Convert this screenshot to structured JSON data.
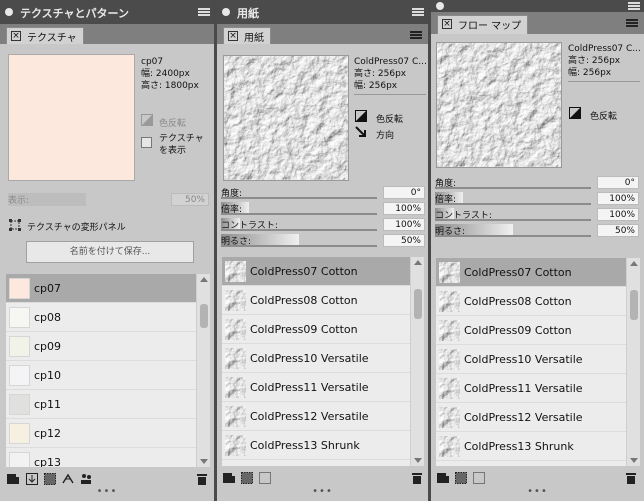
{
  "panels": {
    "texture": {
      "title": "テクスチャとパターン",
      "tab": "テクスチャ",
      "info": {
        "name": "cp07",
        "width": "幅: 2400px",
        "height": "高さ: 1800px"
      },
      "swatch_color": "#fce8dc",
      "invert_label": "色反転",
      "show_texture_label": "テクスチャ を表示",
      "opacity_label": "表示:",
      "opacity_value": "50%",
      "transform_label": "テクスチャの変形パネル",
      "save_button": "名前を付けて保存...",
      "items": [
        {
          "name": "cp07",
          "color": "#fce8dc"
        },
        {
          "name": "cp08",
          "color": "#f6f6f3"
        },
        {
          "name": "cp09",
          "color": "#f2f3e8"
        },
        {
          "name": "cp10",
          "color": "#f4f4f6"
        },
        {
          "name": "cp11",
          "color": "#e0e0df"
        },
        {
          "name": "cp12",
          "color": "#f5f0e0"
        },
        {
          "name": "cp13",
          "color": "#f2f2f2"
        }
      ]
    },
    "paper": {
      "title": "用紙",
      "tab": "用紙",
      "info": {
        "name": "ColdPress07 C...",
        "width": "高さ: 256px",
        "height": "幅: 256px"
      },
      "invert_label": "色反転",
      "direction_label": "方向",
      "sliders": [
        {
          "label": "角度:",
          "value": "0°",
          "level": 0
        },
        {
          "label": "倍率:",
          "value": "100%",
          "level": 0.18
        },
        {
          "label": "コントラスト:",
          "value": "100%",
          "level": 0.12
        },
        {
          "label": "明るさ:",
          "value": "50%",
          "level": 0.5
        }
      ],
      "items": [
        "ColdPress07 Cotton",
        "ColdPress08 Cotton",
        "ColdPress09 Cotton",
        "ColdPress10 Versatile",
        "ColdPress11 Versatile",
        "ColdPress12 Versatile",
        "ColdPress13 Shrunk"
      ]
    },
    "flowmap": {
      "tab": "フロー マップ",
      "info": {
        "name": "ColdPress07 C...",
        "width": "高さ: 256px",
        "height": "幅: 256px"
      },
      "invert_label": "色反転",
      "sliders": [
        {
          "label": "角度:",
          "value": "0°",
          "level": 0
        },
        {
          "label": "倍率:",
          "value": "100%",
          "level": 0.18
        },
        {
          "label": "コントラスト:",
          "value": "100%",
          "level": 0.12
        },
        {
          "label": "明るさ:",
          "value": "50%",
          "level": 0.5
        }
      ],
      "items": [
        "ColdPress07 Cotton",
        "ColdPress08 Cotton",
        "ColdPress09 Cotton",
        "ColdPress10 Versatile",
        "ColdPress11 Versatile",
        "ColdPress12 Versatile",
        "ColdPress13 Shrunk"
      ]
    }
  },
  "icons": {
    "menu": "hamburger-icon",
    "close": "close-icon",
    "invert": "invert-icon",
    "direction": "direction-arrow-icon",
    "transform": "transform-icon",
    "new": "new-layer-icon",
    "import": "import-icon",
    "capture": "capture-icon",
    "flip": "flip-icon",
    "users": "users-icon",
    "trash": "trash-icon"
  },
  "more_dots": "•••"
}
